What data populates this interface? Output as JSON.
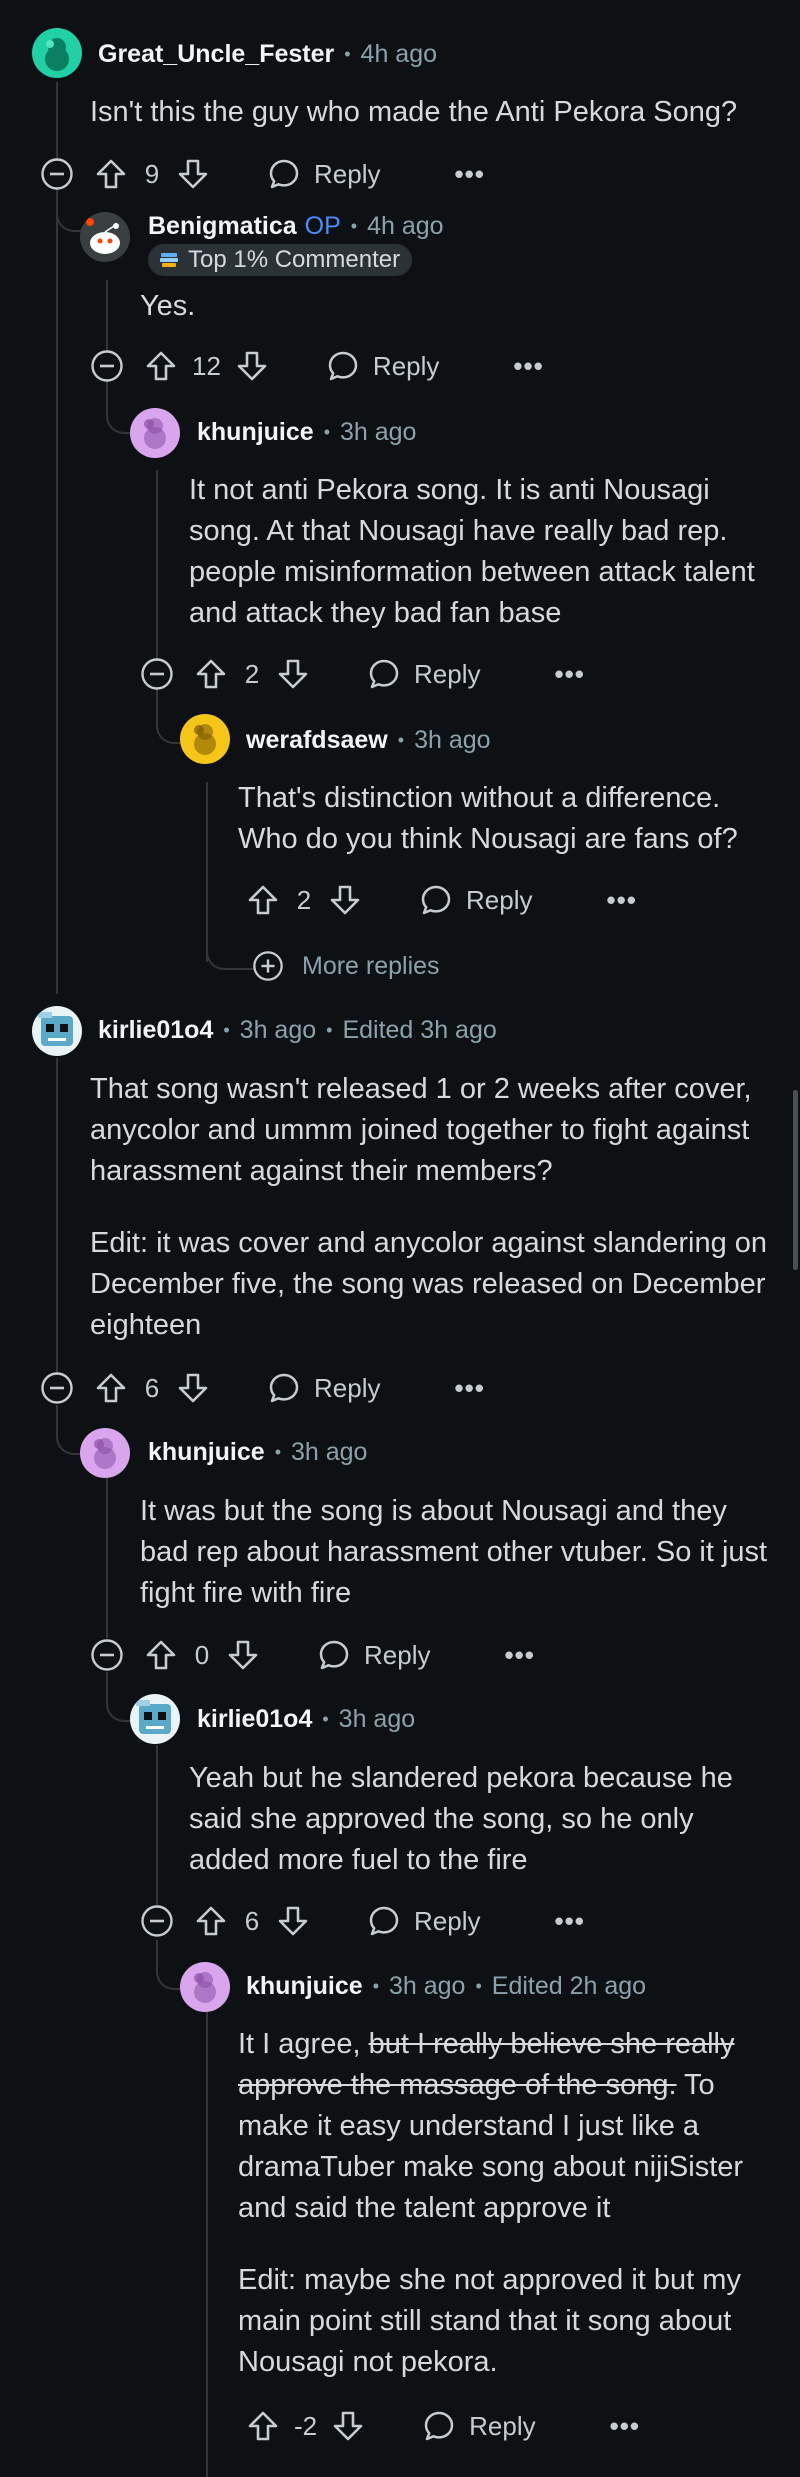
{
  "comments": [
    {
      "username": "Great_Uncle_Fester",
      "time": "4h ago",
      "body": [
        "Isn't this the guy who made the Anti Pekora Song?"
      ],
      "score": "9",
      "reply_label": "Reply",
      "more_label": "•••",
      "avatar_color": "#1fd1a5"
    },
    {
      "username": "Benigmatica",
      "op_badge": "OP",
      "time": "4h ago",
      "flair": "Top 1% Commenter",
      "body": [
        "Yes."
      ],
      "score": "12",
      "reply_label": "Reply",
      "more_label": "•••"
    },
    {
      "username": "khunjuice",
      "time": "3h ago",
      "body": [
        "It not anti Pekora song. It is anti Nousagi song. At that Nousagi have really bad rep. people misinformation between attack talent and attack they bad fan base"
      ],
      "score": "2",
      "reply_label": "Reply",
      "more_label": "•••",
      "avatar_color": "#d9a6ee"
    },
    {
      "username": "werafdsaew",
      "time": "3h ago",
      "body": [
        "That's distinction without a difference. Who do you think Nousagi are fans of?"
      ],
      "score": "2",
      "reply_label": "Reply",
      "more_label": "•••",
      "avatar_color": "#f5c518"
    },
    {
      "username": "kirlie01o4",
      "time": "3h ago",
      "edited": "Edited 3h ago",
      "body": [
        "That song wasn't released 1 or 2 weeks after cover, anycolor and ummm joined together to fight against harassment against their members?",
        "Edit: it was cover and anycolor against slandering on December five, the song was released on December eighteen"
      ],
      "score": "6",
      "reply_label": "Reply",
      "more_label": "•••"
    },
    {
      "username": "khunjuice",
      "time": "3h ago",
      "body": [
        "It was but the song is about Nousagi and they bad rep about harassment other vtuber. So it just fight fire with fire"
      ],
      "score": "0",
      "reply_label": "Reply",
      "more_label": "•••",
      "avatar_color": "#d9a6ee"
    },
    {
      "username": "kirlie01o4",
      "time": "3h ago",
      "body": [
        "Yeah but he slandered pekora because he said she approved the song, so he only added more fuel to the fire"
      ],
      "score": "6",
      "reply_label": "Reply",
      "more_label": "•••"
    },
    {
      "username": "khunjuice",
      "time": "3h ago",
      "edited": "Edited 2h ago",
      "body_prefix": "It I agree, ",
      "body_strike": "but I really believe she really approve the massage of the song.",
      "body_suffix": " To make it easy understand I just like a dramaTuber make song about nijiSister and said the talent approve it",
      "body_edit": "Edit: maybe she not approved it but my main point still stand that it song about Nousagi not pekora.",
      "score": "-2",
      "reply_label": "Reply",
      "more_label": "•••",
      "avatar_color": "#d9a6ee"
    }
  ],
  "more_replies_label": "More replies",
  "dot_separator": "•",
  "colors": {
    "background": "#0e1113",
    "text": "#d7dadc",
    "muted": "#8ba2ad",
    "op_blue": "#4a8cff",
    "thread_line": "#343536"
  }
}
